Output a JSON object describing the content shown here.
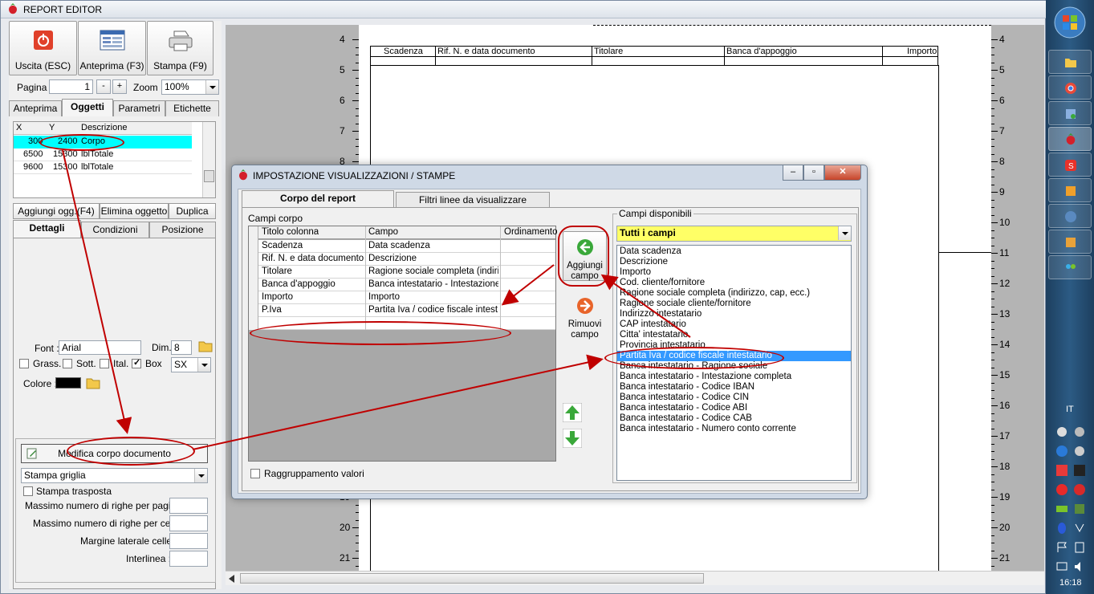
{
  "window": {
    "title": "REPORT EDITOR",
    "ghost_title": "· · · · · · · ·"
  },
  "toolbar": {
    "exit_label": "Uscita (ESC)",
    "preview_label": "Anteprima (F3)",
    "print_label": "Stampa (F9)"
  },
  "paging": {
    "page_label": "Pagina",
    "page_value": "1",
    "minus": "-",
    "plus": "+",
    "zoom_label": "Zoom",
    "zoom_value": "100%"
  },
  "top_tabs": [
    "Anteprima",
    "Oggetti",
    "Parametri",
    "Etichette"
  ],
  "objects_grid": {
    "headers": [
      "X",
      "Y",
      "Descrizione"
    ],
    "rows": [
      {
        "x": "300",
        "y": "2400",
        "desc": "Corpo"
      },
      {
        "x": "6500",
        "y": "15300",
        "desc": "lblTotale"
      },
      {
        "x": "9600",
        "y": "15300",
        "desc": "lblTotale"
      }
    ]
  },
  "object_actions": {
    "add": "Aggiungi ogg.(F4)",
    "delete": "Elimina oggetto",
    "duplicate": "Duplica"
  },
  "detail_tabs": [
    "Dettagli",
    "Condizioni",
    "Posizione"
  ],
  "font": {
    "font_label": "Font :",
    "font_value": "Arial",
    "dim_label": "Dim.",
    "dim_value": "8",
    "bold_label": "Grass.",
    "underline_label": "Sott.",
    "italic_label": "Ital.",
    "box_label": "Box",
    "align_value": "SX",
    "color_label": "Colore :"
  },
  "body_section": {
    "edit_button": "Modifica corpo documento",
    "print_mode": "Stampa griglia",
    "transpose_label": "Stampa trasposta",
    "max_rows_page": "Massimo numero di righe per pagina :",
    "max_rows_cell": "Massimo numero di righe per cella :",
    "cell_margin": "Margine laterale celle :",
    "line_spacing": "Interlinea :"
  },
  "ruler": [
    "4",
    "5",
    "6",
    "7",
    "8",
    "9",
    "10",
    "11",
    "12",
    "13",
    "14",
    "15",
    "16",
    "17",
    "18",
    "19",
    "20",
    "21"
  ],
  "page_header": [
    "Scadenza",
    "Rif. N. e data documento",
    "Titolare",
    "Banca d'appoggio",
    "Importo"
  ],
  "dialog": {
    "title": "IMPOSTAZIONE VISUALIZZAZIONI / STAMPE",
    "tabs": [
      "Corpo del report",
      "Filtri linee da visualizzare"
    ],
    "fields_label": "Campi corpo",
    "columns": [
      "Titolo colonna",
      "Campo",
      "Ordinamento"
    ],
    "rows": [
      {
        "title": "Scadenza",
        "field": "Data scadenza",
        "order": ""
      },
      {
        "title": "Rif. N. e data documento",
        "field": "Descrizione",
        "order": ""
      },
      {
        "title": "Titolare",
        "field": "Ragione sociale completa (indiri...",
        "order": ""
      },
      {
        "title": "Banca d'appoggio",
        "field": "Banca intestatario - Intestazione...",
        "order": ""
      },
      {
        "title": "Importo",
        "field": "Importo",
        "order": ""
      },
      {
        "title": "P.Iva",
        "field": "Partita Iva / codice fiscale intest...",
        "order": ""
      }
    ],
    "add_field_label": "Aggiungi campo",
    "remove_field_label": "Rimuovi campo",
    "grouping_label": "Raggruppamento valori",
    "available_label": "Campi disponibili",
    "filter_value": "Tutti i campi",
    "available_fields": [
      "Data scadenza",
      "Descrizione",
      "Importo",
      "Cod. cliente/fornitore",
      "Ragione sociale completa (indirizzo, cap, ecc.)",
      "Ragione sociale cliente/fornitore",
      "Indirizzo intestatario",
      "CAP intestatario",
      "Citta' intestatario",
      "Provincia intestatario",
      "Partita Iva / codice fiscale intestatario",
      "Banca intestatario - Ragione sociale",
      "Banca intestatario - Intestazione completa",
      "Banca intestatario - Codice IBAN",
      "Banca intestatario - Codice CIN",
      "Banca intestatario - Codice ABI",
      "Banca intestatario - Codice CAB",
      "Banca intestatario - Numero conto corrente"
    ],
    "selected_index": 10
  },
  "taskbar": {
    "language": "IT",
    "clock": "16:18"
  },
  "colors": {
    "accent_highlight": "#3399ff",
    "annotation": "#c00000",
    "grid_selected": "#00ffff",
    "filter_combo": "#ffff66"
  }
}
